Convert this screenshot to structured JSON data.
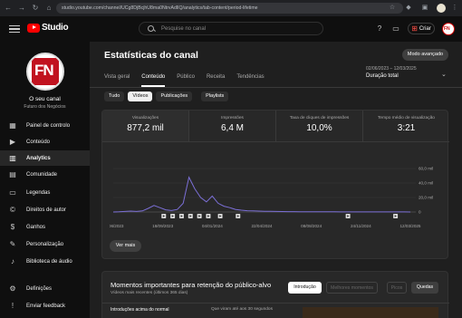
{
  "browser": {
    "url": "studio.youtube.com/channel/UCg8DjBcjhU8ma0NtrvAdlIQ/analytics/tab-content/period-lifetime"
  },
  "topbar": {
    "logo_text": "Studio",
    "search_placeholder": "Pesquise no canal",
    "create_label": "Criar"
  },
  "sidebar": {
    "channel_name": "O seu canal",
    "channel_sub": "Futuro dos Negócios",
    "items": [
      {
        "label": "Painel de controlo",
        "icon": "dashboard-icon"
      },
      {
        "label": "Conteúdo",
        "icon": "content-icon"
      },
      {
        "label": "Analytics",
        "icon": "analytics-icon",
        "active": true
      },
      {
        "label": "Comunidade",
        "icon": "community-icon"
      },
      {
        "label": "Legendas",
        "icon": "subtitles-icon"
      },
      {
        "label": "Direitos de autor",
        "icon": "copyright-icon"
      },
      {
        "label": "Ganhos",
        "icon": "earn-icon"
      },
      {
        "label": "Personalização",
        "icon": "customization-icon"
      },
      {
        "label": "Biblioteca de áudio",
        "icon": "audio-library-icon"
      },
      {
        "label": "Definições",
        "icon": "settings-icon"
      },
      {
        "label": "Enviar feedback",
        "icon": "feedback-icon"
      }
    ]
  },
  "main": {
    "title": "Estatísticas do canal",
    "advanced_button": "Modo avançado",
    "tabs": [
      "Vista geral",
      "Conteúdo",
      "Público",
      "Receita",
      "Tendências"
    ],
    "active_tab": "Conteúdo",
    "period": {
      "range": "02/06/2023 – 12/03/2025",
      "label": "Duração total"
    },
    "chips": [
      "Tudo",
      "Vídeos",
      "Publicações",
      "Playlists"
    ],
    "active_chip": "Vídeos"
  },
  "metrics": [
    {
      "label": "Visualizações",
      "value": "877,2 mil"
    },
    {
      "label": "Impressões",
      "value": "6,4 M"
    },
    {
      "label": "Taxa de cliques de impressões",
      "value": "10,0%"
    },
    {
      "label": "Tempo médio de visualização",
      "value": "3:21"
    }
  ],
  "chart_data": {
    "type": "line",
    "x": [
      "02/06/2023",
      "18/09/2023",
      "04/01/2024",
      "22/04/2024",
      "08/08/2024",
      "24/11/2024",
      "12/03/2025"
    ],
    "ylim": [
      0,
      60000
    ],
    "ytick_labels": [
      "60,0 mil",
      "40,0 mil",
      "20,0 mil",
      "0"
    ],
    "series": [
      {
        "values": [
          0,
          300,
          800,
          1200,
          800,
          1500,
          5000,
          9000,
          6000,
          3000,
          2000,
          3500,
          12000,
          48000,
          32000,
          20000,
          14000,
          22000,
          12000,
          8000,
          6000,
          3500,
          2500,
          1800,
          1500,
          1200,
          1000,
          900,
          700,
          600,
          500,
          450,
          400,
          350,
          300,
          280,
          250,
          220,
          200,
          180,
          160,
          150,
          140,
          130,
          120,
          110,
          100,
          90,
          80,
          80,
          70,
          60
        ]
      }
    ],
    "accent_color": "#7b6fd6"
  },
  "see_more": "Ver mais",
  "retention": {
    "title": "Momentos importantes para retenção do público-alvo",
    "subtitle": "Vídeos mais recentes (últimos 365 dias)",
    "buttons": [
      "Introdução",
      "Melhores momentos",
      "Picos",
      "Quedas"
    ],
    "left_label": "Introduções acima do normal",
    "right_label": "Que viram até aos 30 segundos"
  }
}
